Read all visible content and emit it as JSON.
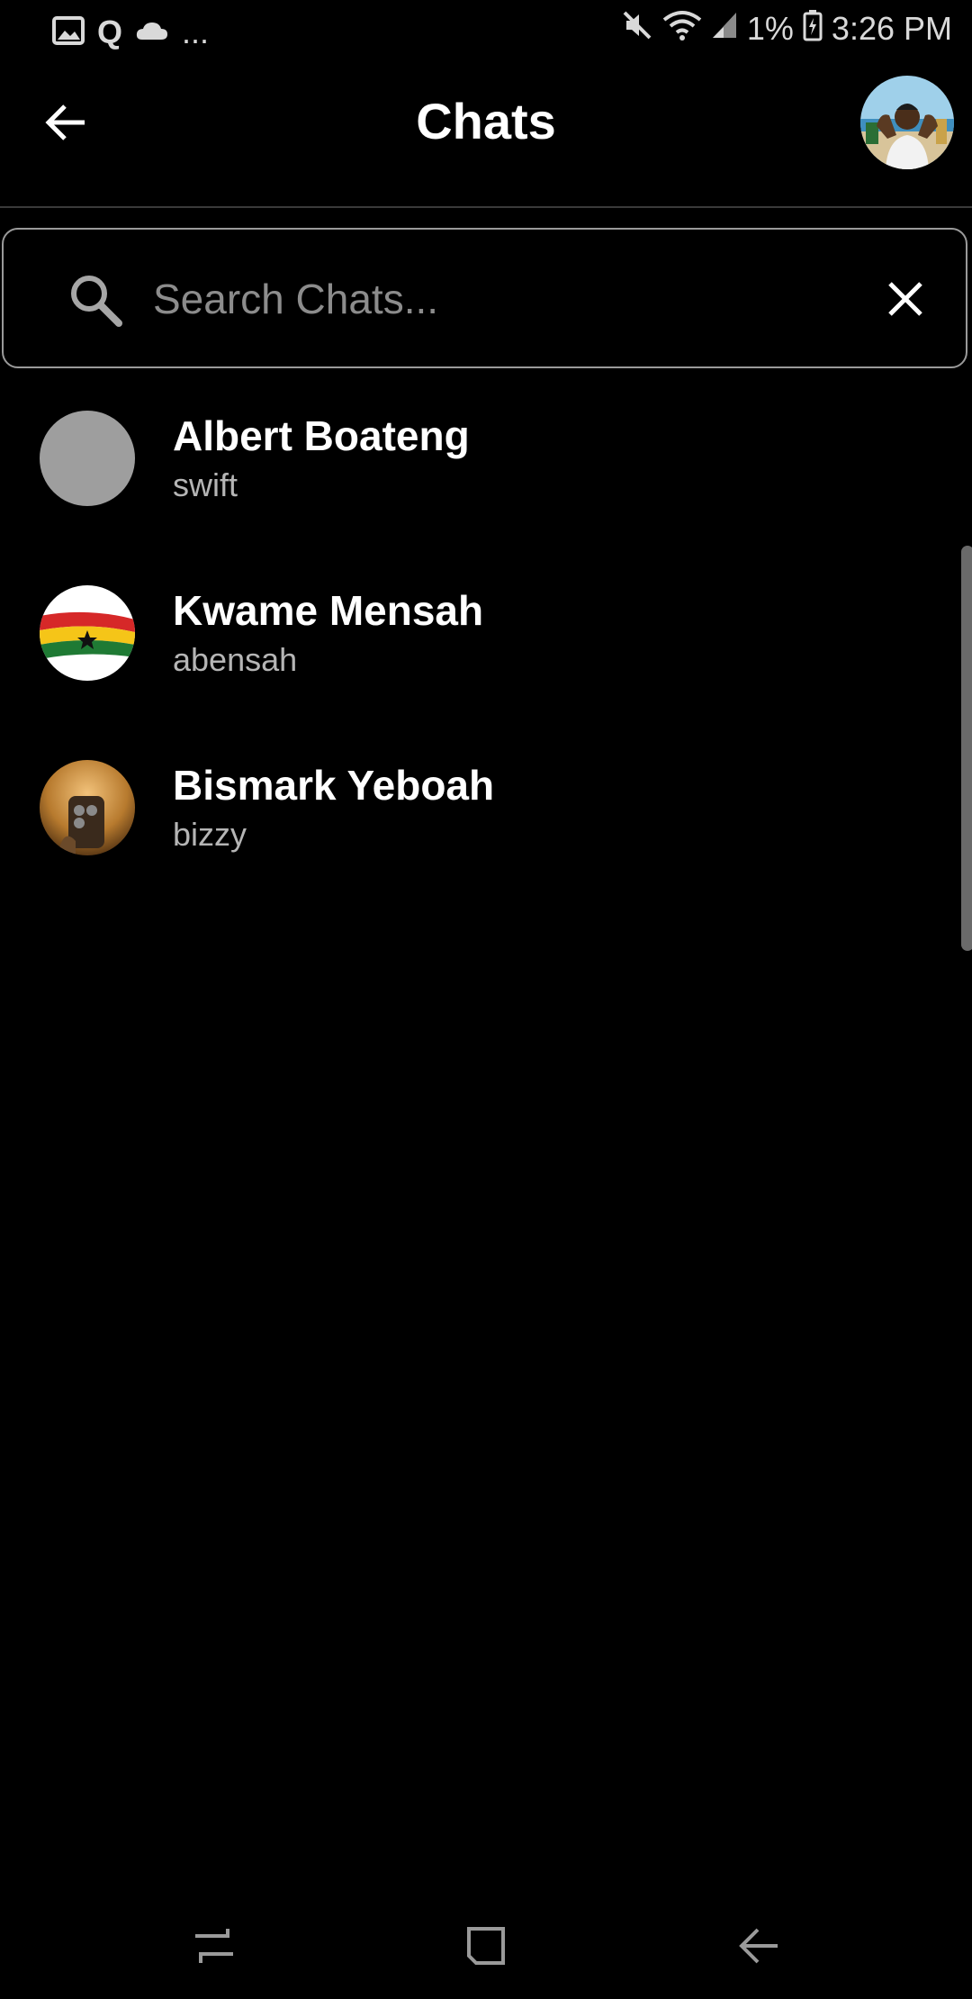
{
  "status_bar": {
    "notification_icons": [
      "gallery-icon",
      "quora-icon",
      "cloud-icon"
    ],
    "more_notifications": "...",
    "battery": "1%",
    "time": "3:26 PM",
    "right_icons": [
      "mute-icon",
      "wifi-icon",
      "signal-icon",
      "battery-charging-icon"
    ]
  },
  "header": {
    "title": "Chats",
    "back_icon": "back-arrow-icon",
    "profile_avatar": "user-photo"
  },
  "search": {
    "placeholder": "Search Chats...",
    "value": "",
    "search_icon": "search-icon",
    "clear_icon": "close-icon"
  },
  "chats": [
    {
      "name": "Albert Boateng",
      "username": "swift",
      "avatar": "grey-placeholder"
    },
    {
      "name": "Kwame Mensah",
      "username": "abensah",
      "avatar": "ghana-flag"
    },
    {
      "name": "Bismark Yeboah",
      "username": "bizzy",
      "avatar": "selfie-photo"
    }
  ],
  "nav_bar": {
    "icons": [
      "recent-apps-icon",
      "home-icon",
      "back-icon"
    ]
  },
  "colors": {
    "background": "#000000",
    "text_primary": "#ffffff",
    "text_secondary": "#b5b5b5",
    "placeholder": "#8c8c8c",
    "border": "#9a9a9a"
  }
}
